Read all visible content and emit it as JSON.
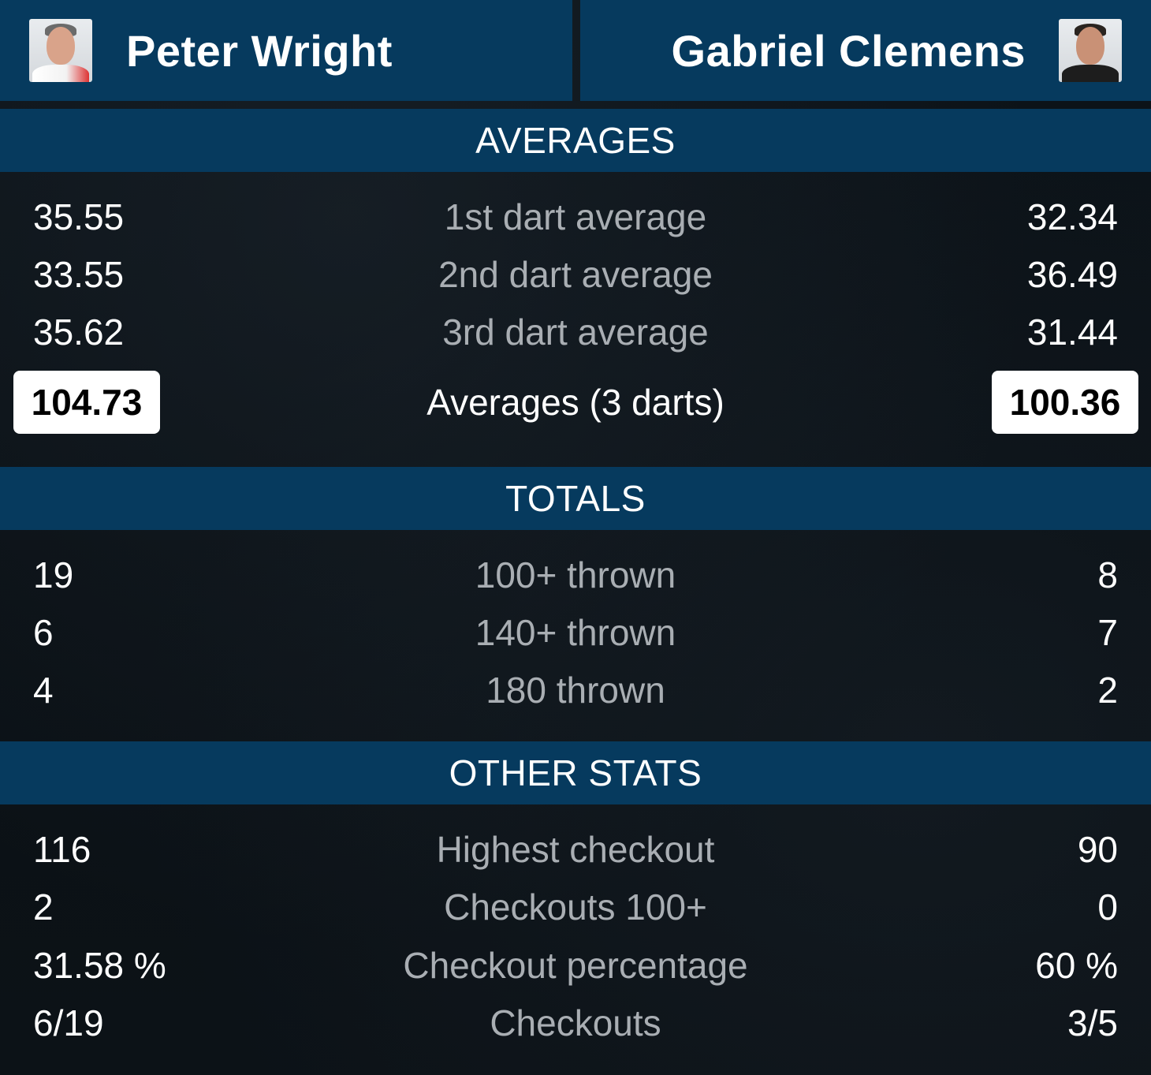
{
  "header": {
    "left_player": {
      "name": "Peter Wright",
      "avatar_icon": "player-photo-icon"
    },
    "right_player": {
      "name": "Gabriel Clemens",
      "avatar_icon": "player-photo-icon"
    }
  },
  "colors": {
    "header_bg": "#063a5e",
    "page_bg": "#0b1116",
    "label_text": "#a9aeb3",
    "value_text": "#ffffff"
  },
  "sections": {
    "averages": {
      "title": "AVERAGES",
      "rows": [
        {
          "label": "1st dart average",
          "left": "35.55",
          "right": "32.34"
        },
        {
          "label": "2nd dart average",
          "left": "33.55",
          "right": "36.49"
        },
        {
          "label": "3rd dart average",
          "left": "35.62",
          "right": "31.44"
        },
        {
          "label": "Averages (3 darts)",
          "left": "104.73",
          "right": "100.36"
        }
      ]
    },
    "totals": {
      "title": "TOTALS",
      "rows": [
        {
          "label": "100+ thrown",
          "left": "19",
          "right": "8"
        },
        {
          "label": "140+ thrown",
          "left": "6",
          "right": "7"
        },
        {
          "label": "180 thrown",
          "left": "4",
          "right": "2"
        }
      ]
    },
    "other": {
      "title": "OTHER STATS",
      "rows": [
        {
          "label": "Highest checkout",
          "left": "116",
          "right": "90"
        },
        {
          "label": "Checkouts 100+",
          "left": "2",
          "right": "0"
        },
        {
          "label": "Checkout percentage",
          "left": "31.58 %",
          "right": "60 %"
        },
        {
          "label": "Checkouts",
          "left": "6/19",
          "right": "3/5"
        }
      ]
    }
  }
}
